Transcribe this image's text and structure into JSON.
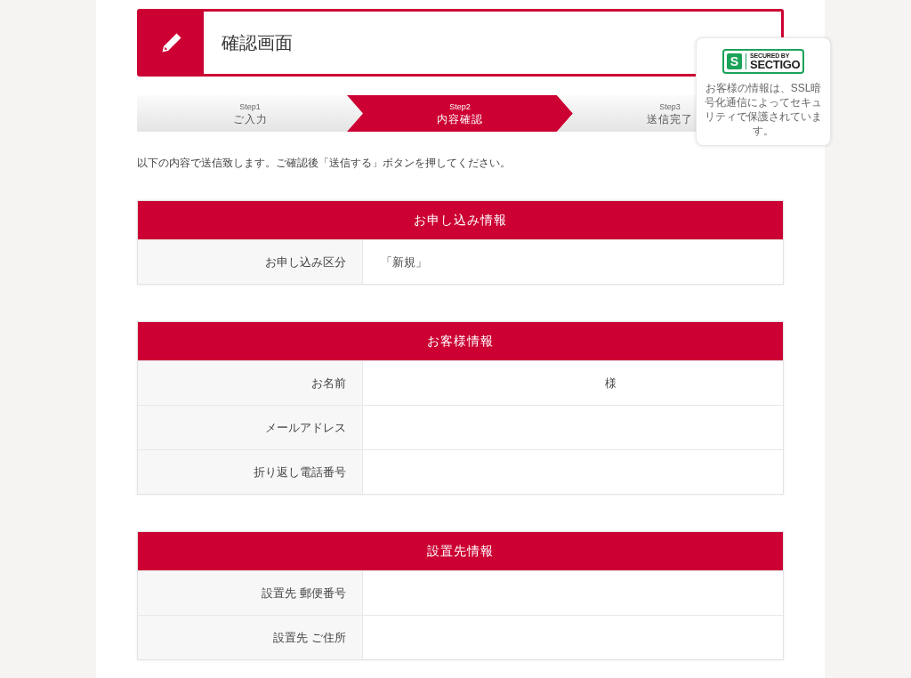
{
  "header": {
    "title": "確認画面"
  },
  "steps": [
    {
      "step": "Step1",
      "label": "ご入力",
      "current": false
    },
    {
      "step": "Step2",
      "label": "内容確認",
      "current": true
    },
    {
      "step": "Step3",
      "label": "送信完了",
      "current": false
    }
  ],
  "security_badge": {
    "logo_mark": "S",
    "logo_top": "SECURED BY",
    "logo_bottom": "SECTIGO",
    "text": "お客様の情報は、SSL暗号化通信によってセキュリティで保護されています。"
  },
  "intro": "以下の内容で送信致します。ご確認後「送信する」ボタンを押してください。",
  "sections": [
    {
      "title": "お申し込み情報",
      "rows": [
        {
          "label": "お申し込み区分",
          "value": "「新規」",
          "kind": "text"
        }
      ]
    },
    {
      "title": "お客様情報",
      "rows": [
        {
          "label": "お名前",
          "value": "様",
          "kind": "name"
        },
        {
          "label": "メールアドレス",
          "kind": "text"
        },
        {
          "label": "折り返し電話番号",
          "kind": "text"
        }
      ]
    },
    {
      "title": "設置先情報",
      "rows": [
        {
          "label": "設置先 郵便番号",
          "kind": "text"
        },
        {
          "label": "設置先 ご住所",
          "kind": "text"
        }
      ]
    }
  ]
}
